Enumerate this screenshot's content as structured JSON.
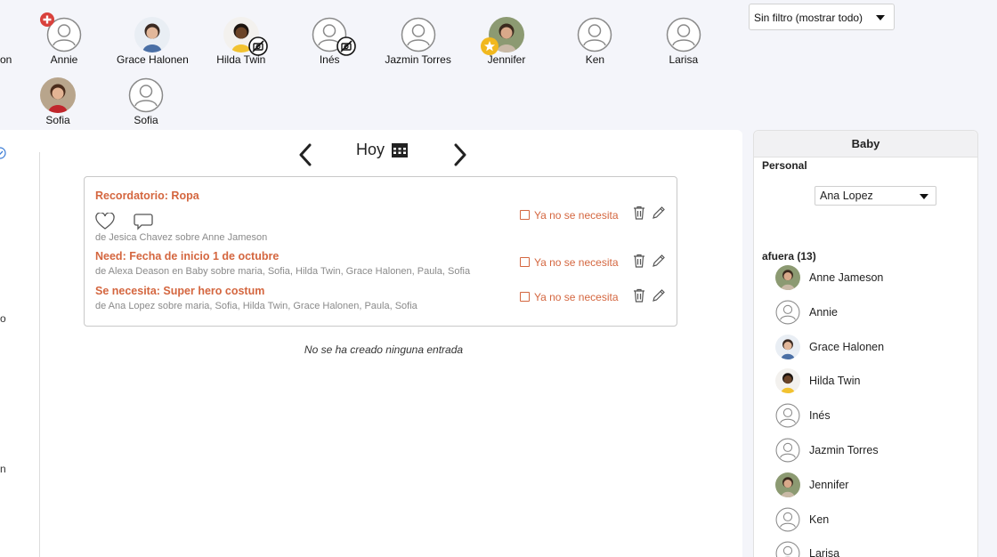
{
  "children": [
    {
      "name": "Annie",
      "photo": false,
      "badge": "add"
    },
    {
      "name": "Grace Halonen",
      "photo": true,
      "tone": "blue-dress"
    },
    {
      "name": "Hilda Twin",
      "photo": true,
      "tone": "dark",
      "badge": "no-photo"
    },
    {
      "name": "Inés",
      "photo": false,
      "badge": "no-photo"
    },
    {
      "name": "Jazmin Torres",
      "photo": false
    },
    {
      "name": "Jennifer",
      "photo": true,
      "tone": "park",
      "badge": "star"
    },
    {
      "name": "Ken",
      "photo": false
    },
    {
      "name": "Larisa",
      "photo": false
    },
    {
      "name": "Sofia",
      "photo": true,
      "tone": "red-dress"
    },
    {
      "name": "Sofia",
      "photo": false
    }
  ],
  "clipped_left_label": "on",
  "filter": {
    "selected": "Sin filtro (mostrar todo)"
  },
  "left_edge_chars": [
    "o",
    "n"
  ],
  "date_nav": {
    "label": "Hoy"
  },
  "entries": [
    {
      "title": "Recordatorio: Ropa",
      "meta": "de Jesica Chavez sobre Anne Jameson",
      "need": "Ya no se necesita"
    },
    {
      "title": "Need: Fecha de inicio 1 de octubre",
      "meta": "de Alexa Deason en Baby sobre maria, Sofia, Hilda Twin, Grace Halonen, Paula, Sofia",
      "need": "Ya no se necesita"
    },
    {
      "title": "Se necesita: Super hero costum",
      "meta": "de Ana Lopez sobre maria, Sofia, Hilda Twin, Grace Halonen, Paula, Sofia",
      "need": "Ya no se necesita"
    }
  ],
  "empty_message": "No se ha creado ninguna entrada",
  "side": {
    "title": "Baby",
    "personal_label": "Personal",
    "staff_selected": "Ana Lopez",
    "out_label": "afuera (13)",
    "out_list": [
      {
        "name": "Anne Jameson",
        "photo": true,
        "tone": "park"
      },
      {
        "name": "Annie",
        "photo": false
      },
      {
        "name": "Grace Halonen",
        "photo": true,
        "tone": "blue-dress"
      },
      {
        "name": "Hilda Twin",
        "photo": true,
        "tone": "dark"
      },
      {
        "name": "Inés",
        "photo": false
      },
      {
        "name": "Jazmin Torres",
        "photo": false
      },
      {
        "name": "Jennifer",
        "photo": true,
        "tone": "park"
      },
      {
        "name": "Ken",
        "photo": false
      },
      {
        "name": "Larisa",
        "photo": false
      }
    ]
  },
  "colors": {
    "accent": "#d4663f",
    "panel": "#ffffff",
    "page": "#f4f5fa"
  }
}
